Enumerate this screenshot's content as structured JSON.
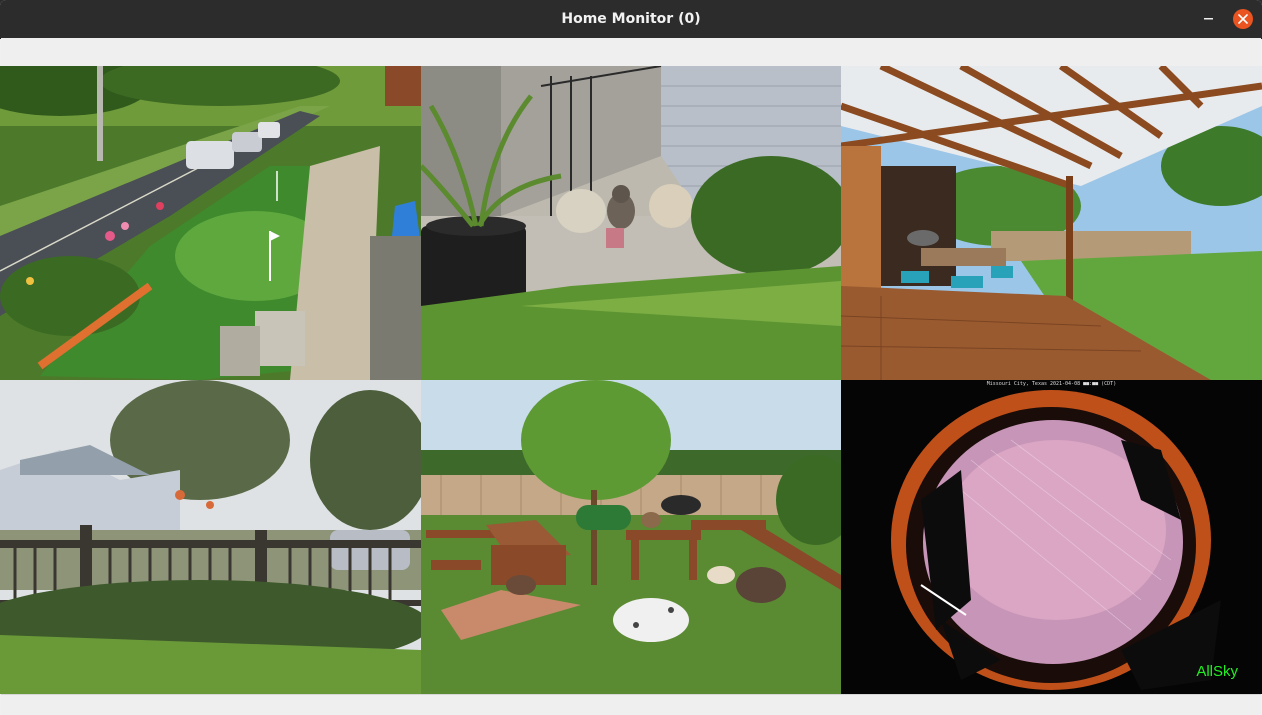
{
  "window": {
    "title": "Home Monitor (0)"
  },
  "cameras": [
    {
      "id": "cam1",
      "label": "",
      "scene": "front-yard-putting-green"
    },
    {
      "id": "cam2",
      "label": "",
      "scene": "porch-steps-cat"
    },
    {
      "id": "cam3",
      "label": "",
      "scene": "back-deck-pergola"
    },
    {
      "id": "cam4",
      "label": "",
      "scene": "side-fence-garden"
    },
    {
      "id": "cam5",
      "label": "",
      "scene": "dog-play-yard"
    },
    {
      "id": "cam6",
      "label": "AllSky",
      "banner": "Missouri City, Texas 2021-04-08 ■■:■■ (CDT)",
      "scene": "allsky-fisheye"
    }
  ],
  "colors": {
    "titlebar": "#2c2c2c",
    "close_button": "#e95420",
    "allsky_label": "#22ee22"
  },
  "icons": {
    "minimize": "minimize-icon",
    "close": "close-icon"
  }
}
